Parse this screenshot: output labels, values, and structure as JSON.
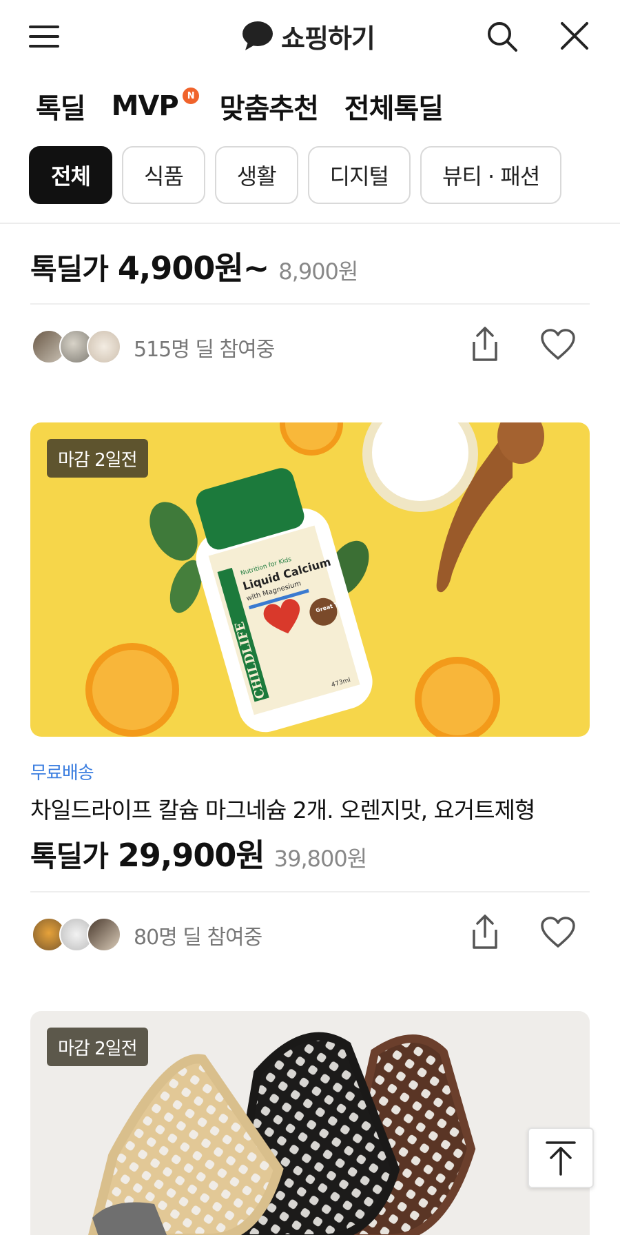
{
  "header": {
    "title": "쇼핑하기",
    "menu_icon": "hamburger-menu-icon",
    "search_icon": "search-icon",
    "close_icon": "close-icon"
  },
  "main_tabs": [
    {
      "label": "톡딜",
      "active": true
    },
    {
      "label": "MVP",
      "badge": "N"
    },
    {
      "label": "맞춤추천"
    },
    {
      "label": "전체톡딜"
    }
  ],
  "categories": [
    {
      "label": "전체",
      "active": true
    },
    {
      "label": "식품"
    },
    {
      "label": "생활"
    },
    {
      "label": "디지털"
    },
    {
      "label": "뷰티 · 패션"
    }
  ],
  "products": [
    {
      "price_label": "톡딜가",
      "price": "4,900원~",
      "original_price": "8,900원",
      "participants": "515명 딜 참여중"
    },
    {
      "deadline": "마감 2일전",
      "shipping": "무료배송",
      "name": "차일드라이프 칼슘 마그네슘 2개. 오렌지맛, 요거트제형",
      "price_label": "톡딜가",
      "price": "29,900원",
      "original_price": "39,800원",
      "participants": "80명 딜 참여중",
      "image_text": {
        "brand": "CHILDLIFE",
        "product": "Liquid Calcium",
        "sub": "with Magnesium",
        "tag": "Nutrition for Kids",
        "badge": "Great Taste",
        "volume": "473ml"
      }
    },
    {
      "deadline": "마감 2일전"
    }
  ],
  "colors": {
    "accent_yellow": "#fbe24b",
    "badge_orange": "#f0632b",
    "free_shipping_blue": "#3d7fe0"
  }
}
